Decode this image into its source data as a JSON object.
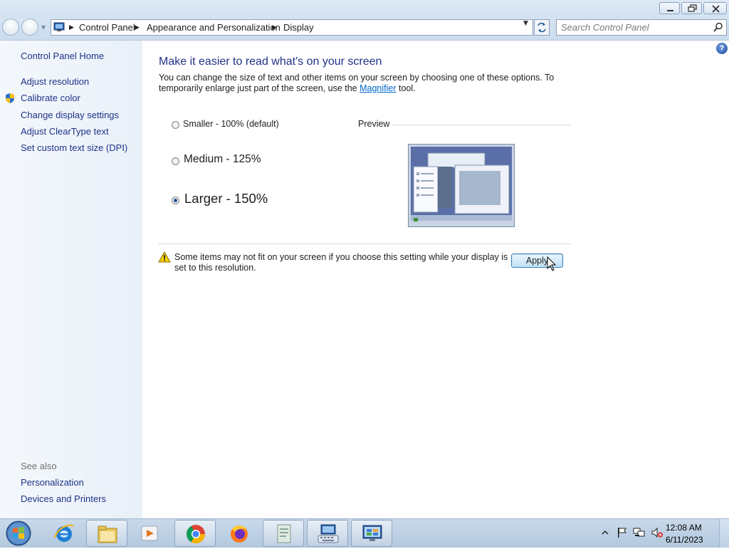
{
  "window": {
    "caption_buttons": [
      "minimize",
      "maximize",
      "close"
    ]
  },
  "address_bar": {
    "breadcrumbs": [
      "Control Panel",
      "Appearance and Personalization",
      "Display"
    ],
    "search_placeholder": "Search Control Panel"
  },
  "sidebar": {
    "home_link": "Control Panel Home",
    "items": [
      {
        "label": "Adjust resolution",
        "icon": ""
      },
      {
        "label": "Calibrate color",
        "icon": "uac-shield-icon"
      },
      {
        "label": "Change display settings",
        "icon": ""
      },
      {
        "label": "Adjust ClearType text",
        "icon": ""
      },
      {
        "label": "Set custom text size (DPI)",
        "icon": ""
      }
    ],
    "see_also_heading": "See also",
    "see_also": [
      "Personalization",
      "Devices and Printers"
    ]
  },
  "main": {
    "title": "Make it easier to read what's on your screen",
    "intro_before_link": "You can change the size of text and other items on your screen by choosing one of these options. To temporarily enlarge just part of the screen, use the ",
    "intro_link": "Magnifier",
    "intro_after_link": " tool.",
    "options": [
      {
        "label": "Smaller - 100% (default)",
        "checked": false
      },
      {
        "label": "Medium - 125%",
        "checked": false
      },
      {
        "label": "Larger - 150%",
        "checked": true
      }
    ],
    "preview_label": "Preview",
    "warning": "Some items may not fit on your screen if you choose this setting while your display is set to this resolution.",
    "apply_label": "Apply"
  },
  "taskbar": {
    "pinned": [
      "start-orb",
      "internet-explorer-icon",
      "windows-explorer-icon",
      "media-player-icon",
      "chrome-icon",
      "firefox-icon",
      "document-icon",
      "keyboard-settings-icon",
      "control-panel-icon"
    ],
    "tray_icons": [
      "show-hidden-icons",
      "action-center-flag-icon",
      "network-icon",
      "volume-muted-icon"
    ],
    "clock": {
      "time": "12:08 AM",
      "date": "6/11/2023"
    }
  },
  "colors": {
    "link": "#1e3287",
    "hyperlink": "#0066cc",
    "sidebar_bg": "#eef4fa",
    "taskbar_bg": "#c0d3e6"
  }
}
